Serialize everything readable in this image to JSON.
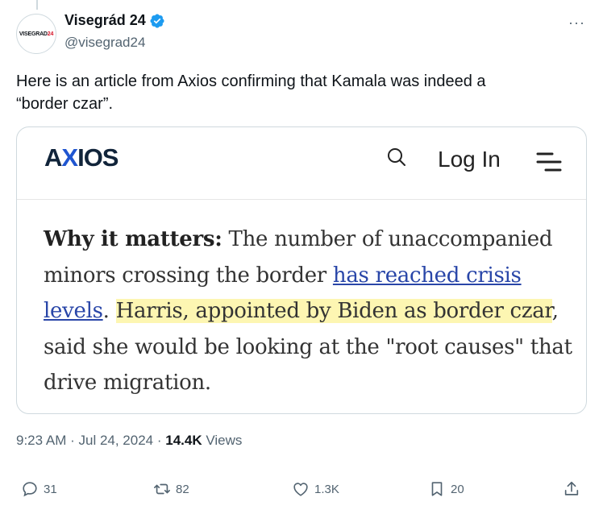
{
  "author": {
    "avatar_text_a": "VISEGRAD",
    "avatar_text_b": "24",
    "display_name": "Visegrád 24",
    "handle": "@visegrad24",
    "more_label": "···"
  },
  "tweet": {
    "text_line1": "Here is an article from Axios confirming that Kamala was indeed a",
    "text_line2": "“border czar”."
  },
  "card": {
    "logo_a": "A",
    "logo_x": "X",
    "logo_b": "IOS",
    "login_label": "Log In",
    "article": {
      "lead": "Why it matters:",
      "part1": " The number of unaccompanied minors crossing the border ",
      "link": "has reached crisis levels",
      "part2": ". ",
      "highlight": "Harris, appointed by Biden as border czar",
      "part3": ", said she would be looking at the \"root causes\" that drive migration."
    }
  },
  "meta": {
    "time": "9:23 AM",
    "sep1": " · ",
    "date": "Jul 24, 2024",
    "sep2": " · ",
    "views_count": "14.4K",
    "views_label": " Views"
  },
  "actions": {
    "replies": "31",
    "reposts": "82",
    "likes": "1.3K",
    "bookmarks": "20"
  },
  "colors": {
    "verified": "#1d9bf0",
    "axios_x": "#1f55d0",
    "link": "#2946a8",
    "highlight": "#fdf6b2"
  }
}
